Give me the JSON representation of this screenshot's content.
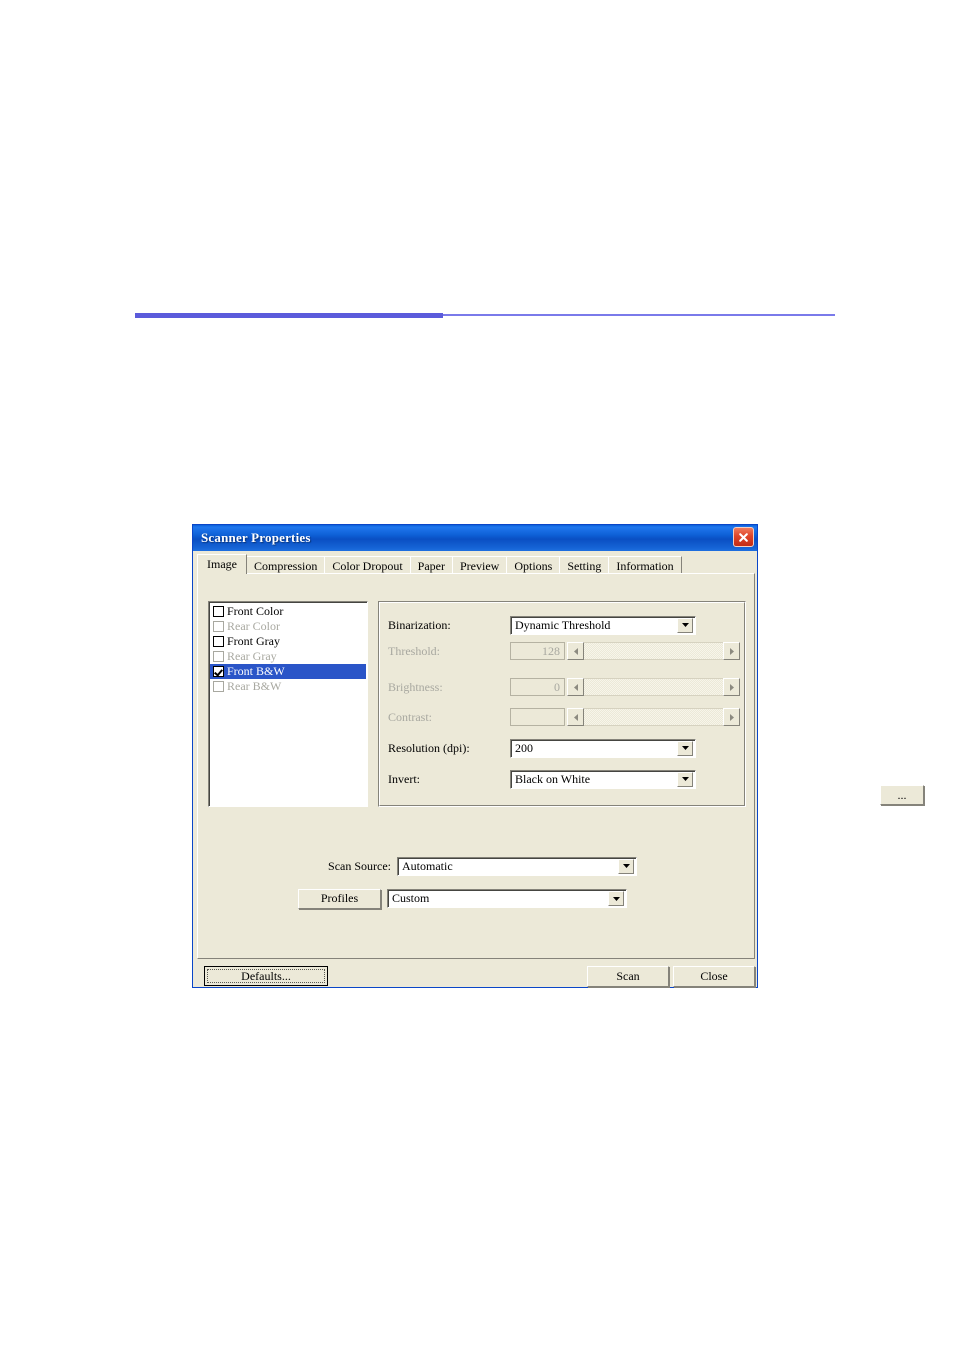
{
  "page": {
    "rule": {
      "color_thick": "#5b5bdb",
      "color_thin": "#7a7aea"
    }
  },
  "dialog": {
    "title": "Scanner Properties",
    "close_icon": "close-x-icon",
    "titlebar_color": "#0a5fd8",
    "face_color": "#ece9d8",
    "tabs": [
      {
        "label": "Image",
        "active": true
      },
      {
        "label": "Compression",
        "active": false
      },
      {
        "label": "Color Dropout",
        "active": false
      },
      {
        "label": "Paper",
        "active": false
      },
      {
        "label": "Preview",
        "active": false
      },
      {
        "label": "Options",
        "active": false
      },
      {
        "label": "Setting",
        "active": false
      },
      {
        "label": "Information",
        "active": false
      }
    ],
    "image_tab": {
      "selection_list": [
        {
          "label": "Front Color",
          "checked": false,
          "enabled": true,
          "selected": false
        },
        {
          "label": "Rear Color",
          "checked": false,
          "enabled": false,
          "selected": false
        },
        {
          "label": "Front Gray",
          "checked": false,
          "enabled": true,
          "selected": false
        },
        {
          "label": "Rear Gray",
          "checked": false,
          "enabled": false,
          "selected": false
        },
        {
          "label": "Front B&W",
          "checked": true,
          "enabled": true,
          "selected": true
        },
        {
          "label": "Rear B&W",
          "checked": false,
          "enabled": false,
          "selected": false
        }
      ],
      "settings": {
        "binarization": {
          "label": "Binarization:",
          "value": "Dynamic Threshold",
          "enabled": true
        },
        "threshold": {
          "label": "Threshold:",
          "value": "128",
          "enabled": false
        },
        "brightness": {
          "label": "Brightness:",
          "value": "0",
          "enabled": false
        },
        "contrast": {
          "label": "Contrast:",
          "value": "",
          "enabled": false
        },
        "resolution": {
          "label": "Resolution (dpi):",
          "value": "200",
          "enabled": true
        },
        "resolution_more_button": "...",
        "invert": {
          "label": "Invert:",
          "value": "Black on White",
          "enabled": true
        }
      },
      "scan_source": {
        "label": "Scan Source:",
        "value": "Automatic"
      },
      "profiles": {
        "button_label": "Profiles",
        "value": "Custom"
      }
    },
    "footer": {
      "defaults_label": "Defaults...",
      "scan_label": "Scan",
      "close_label": "Close"
    }
  }
}
